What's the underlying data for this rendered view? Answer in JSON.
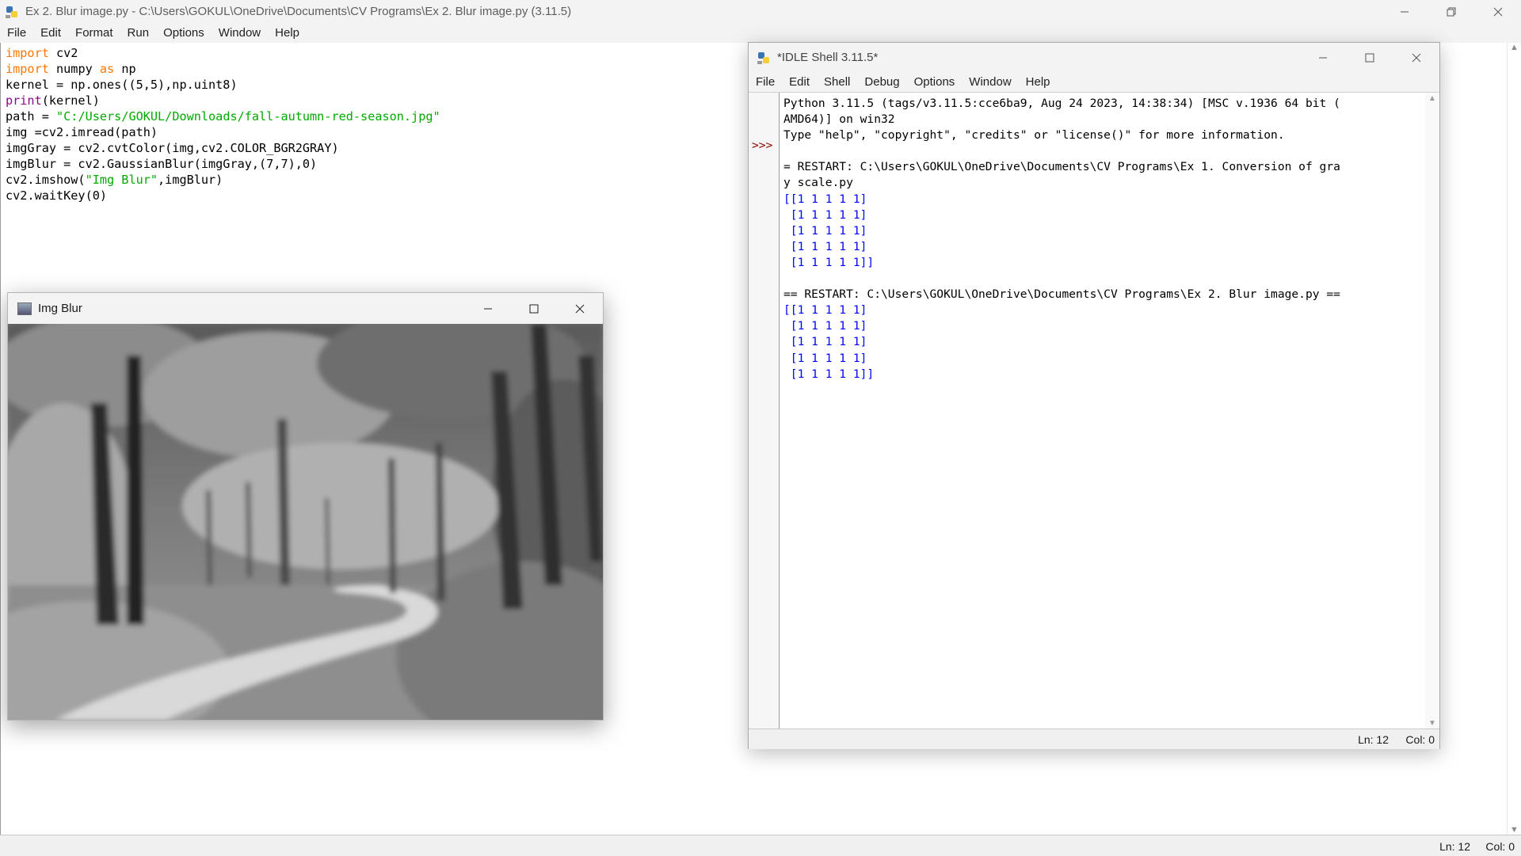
{
  "editor_window": {
    "title": "Ex 2. Blur image.py - C:\\Users\\GOKUL\\OneDrive\\Documents\\CV Programs\\Ex 2. Blur image.py (3.11.5)",
    "menu": [
      "File",
      "Edit",
      "Format",
      "Run",
      "Options",
      "Window",
      "Help"
    ],
    "status": {
      "ln": "Ln: 12",
      "col": "Col: 0"
    }
  },
  "code": {
    "lines": [
      [
        {
          "t": "kw",
          "v": "import"
        },
        {
          "t": "n",
          "v": " cv2"
        }
      ],
      [
        {
          "t": "kw",
          "v": "import"
        },
        {
          "t": "n",
          "v": " numpy "
        },
        {
          "t": "kw",
          "v": "as"
        },
        {
          "t": "n",
          "v": " np"
        }
      ],
      [
        {
          "t": "n",
          "v": "kernel = np.ones((5,5),np.uint8)"
        }
      ],
      [
        {
          "t": "bi",
          "v": "print"
        },
        {
          "t": "n",
          "v": "(kernel)"
        }
      ],
      [
        {
          "t": "n",
          "v": "path = "
        },
        {
          "t": "str",
          "v": "\"C:/Users/GOKUL/Downloads/fall-autumn-red-season.jpg\""
        }
      ],
      [
        {
          "t": "n",
          "v": "img =cv2.imread(path)"
        }
      ],
      [
        {
          "t": "n",
          "v": "imgGray = cv2.cvtColor(img,cv2.COLOR_BGR2GRAY)"
        }
      ],
      [
        {
          "t": "n",
          "v": "imgBlur = cv2.GaussianBlur(imgGray,(7,7),0)"
        }
      ],
      [
        {
          "t": "n",
          "v": "cv2.imshow("
        },
        {
          "t": "str",
          "v": "\"Img Blur\""
        },
        {
          "t": "n",
          "v": ",imgBlur)"
        }
      ],
      [
        {
          "t": "n",
          "v": "cv2.waitKey(0)"
        }
      ]
    ]
  },
  "img_window": {
    "title": "Img Blur"
  },
  "shell_window": {
    "title": "*IDLE Shell 3.11.5*",
    "menu": [
      "File",
      "Edit",
      "Shell",
      "Debug",
      "Options",
      "Window",
      "Help"
    ],
    "prompt": ">>>",
    "lines": [
      {
        "t": "n",
        "v": "Python 3.11.5 (tags/v3.11.5:cce6ba9, Aug 24 2023, 14:38:34) [MSC v.1936 64 bit ("
      },
      {
        "t": "n",
        "v": "AMD64)] on win32"
      },
      {
        "t": "n",
        "v": "Type \"help\", \"copyright\", \"credits\" or \"license()\" for more information."
      },
      {
        "t": "n",
        "v": ""
      },
      {
        "t": "n",
        "v": "= RESTART: C:\\Users\\GOKUL\\OneDrive\\Documents\\CV Programs\\Ex 1. Conversion of gra"
      },
      {
        "t": "n",
        "v": "y scale.py"
      },
      {
        "t": "out",
        "v": "[[1 1 1 1 1]"
      },
      {
        "t": "out",
        "v": " [1 1 1 1 1]"
      },
      {
        "t": "out",
        "v": " [1 1 1 1 1]"
      },
      {
        "t": "out",
        "v": " [1 1 1 1 1]"
      },
      {
        "t": "out",
        "v": " [1 1 1 1 1]]"
      },
      {
        "t": "n",
        "v": ""
      },
      {
        "t": "n",
        "v": "== RESTART: C:\\Users\\GOKUL\\OneDrive\\Documents\\CV Programs\\Ex 2. Blur image.py =="
      },
      {
        "t": "out",
        "v": "[[1 1 1 1 1]"
      },
      {
        "t": "out",
        "v": " [1 1 1 1 1]"
      },
      {
        "t": "out",
        "v": " [1 1 1 1 1]"
      },
      {
        "t": "out",
        "v": " [1 1 1 1 1]"
      },
      {
        "t": "out",
        "v": " [1 1 1 1 1]]"
      }
    ],
    "status": {
      "ln": "Ln: 12",
      "col": "Col: 0"
    }
  },
  "icons": {
    "minimize": "minimize-icon",
    "maximize": "maximize-icon",
    "restore": "restore-icon",
    "close": "close-icon",
    "python": "python-icon"
  },
  "colors": {
    "keyword": "#ff7700",
    "builtin": "#900090",
    "string": "#00aa00",
    "stdout": "#0000ff",
    "prompt": "#8b0000"
  }
}
